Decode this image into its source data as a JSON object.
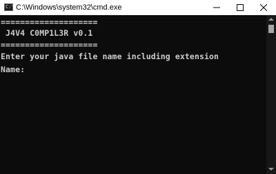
{
  "window": {
    "title": "C:\\Windows\\system32\\cmd.exe",
    "icon_text": "C:\\",
    "controls": [
      "minimize-icon",
      "maximize-icon",
      "close-icon"
    ]
  },
  "console": {
    "lines": [
      "====================",
      " J4V4 C0MP1L3R v0.1",
      "====================",
      "Enter your java file name including extension",
      "Name:"
    ],
    "background": "#0c0c0c",
    "foreground": "#cccccc"
  }
}
